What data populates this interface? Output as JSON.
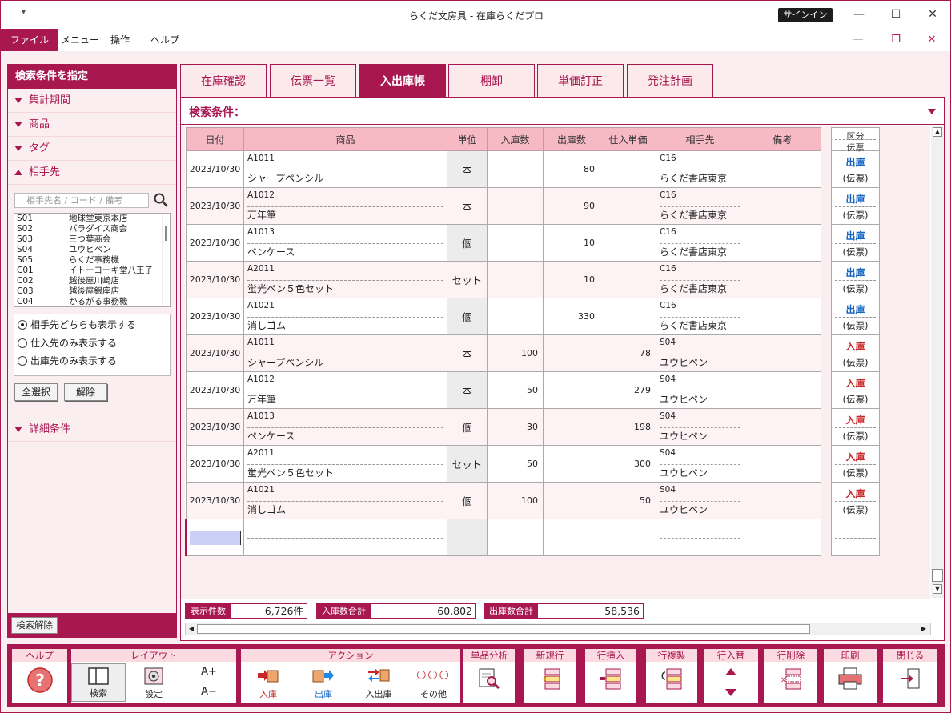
{
  "window": {
    "quick_access": "▾",
    "title": "らくだ文房具 - 在庫らくだプロ",
    "signin": "サインイン"
  },
  "menu": [
    "ファイル",
    "メニュー",
    "操作",
    "ヘルプ"
  ],
  "left": {
    "header": "検索条件を指定",
    "sections": [
      "集計期間",
      "商品",
      "タグ",
      "相手先"
    ],
    "partner_search_placeholder": "相手先名 / コード / 備考",
    "partners": [
      {
        "code": "S01",
        "name": "地球堂東京本店"
      },
      {
        "code": "S02",
        "name": "パラダイス商会"
      },
      {
        "code": "S03",
        "name": "三つ葉商会"
      },
      {
        "code": "S04",
        "name": "ユウヒペン"
      },
      {
        "code": "S05",
        "name": "らくだ事務機"
      },
      {
        "code": "C01",
        "name": "イトーヨーキ堂八王子"
      },
      {
        "code": "C02",
        "name": "越後屋川崎店"
      },
      {
        "code": "C03",
        "name": "越後屋銀座店"
      },
      {
        "code": "C04",
        "name": "かるがる事務機"
      }
    ],
    "radios": [
      "相手先どちらも表示する",
      "仕入先のみ表示する",
      "出庫先のみ表示する"
    ],
    "select_all": "全選択",
    "deselect": "解除",
    "details": "詳細条件",
    "clear_search": "検索解除"
  },
  "tabs": [
    "在庫確認",
    "伝票一覧",
    "入出庫帳",
    "棚卸",
    "単価訂正",
    "発注計画"
  ],
  "active_tab": "入出庫帳",
  "condition_label": "検索条件：",
  "columns": [
    "日付",
    "商品",
    "単位",
    "入庫数",
    "出庫数",
    "仕入単価",
    "相手先",
    "備考"
  ],
  "kubun_header": {
    "top": "区分",
    "bottom": "伝票"
  },
  "rows": [
    {
      "date": "2023/10/30",
      "code": "A1011",
      "name": "シャープペンシル",
      "unit": "本",
      "in": "",
      "out": "80",
      "price": "",
      "pcode": "C16",
      "pname": "らくだ書店東京",
      "kubun": "出庫",
      "slip": "(伝票)"
    },
    {
      "date": "2023/10/30",
      "code": "A1012",
      "name": "万年筆",
      "unit": "本",
      "in": "",
      "out": "90",
      "price": "",
      "pcode": "C16",
      "pname": "らくだ書店東京",
      "kubun": "出庫",
      "slip": "(伝票)"
    },
    {
      "date": "2023/10/30",
      "code": "A1013",
      "name": "ペンケース",
      "unit": "個",
      "in": "",
      "out": "10",
      "price": "",
      "pcode": "C16",
      "pname": "らくだ書店東京",
      "kubun": "出庫",
      "slip": "(伝票)"
    },
    {
      "date": "2023/10/30",
      "code": "A2011",
      "name": "蛍光ペン５色セット",
      "unit": "セット",
      "in": "",
      "out": "10",
      "price": "",
      "pcode": "C16",
      "pname": "らくだ書店東京",
      "kubun": "出庫",
      "slip": "(伝票)"
    },
    {
      "date": "2023/10/30",
      "code": "A1021",
      "name": "消しゴム",
      "unit": "個",
      "in": "",
      "out": "330",
      "price": "",
      "pcode": "C16",
      "pname": "らくだ書店東京",
      "kubun": "出庫",
      "slip": "(伝票)"
    },
    {
      "date": "2023/10/30",
      "code": "A1011",
      "name": "シャープペンシル",
      "unit": "本",
      "in": "100",
      "out": "",
      "price": "78",
      "pcode": "S04",
      "pname": "ユウヒペン",
      "kubun": "入庫",
      "slip": "(伝票)"
    },
    {
      "date": "2023/10/30",
      "code": "A1012",
      "name": "万年筆",
      "unit": "本",
      "in": "50",
      "out": "",
      "price": "279",
      "pcode": "S04",
      "pname": "ユウヒペン",
      "kubun": "入庫",
      "slip": "(伝票)"
    },
    {
      "date": "2023/10/30",
      "code": "A1013",
      "name": "ペンケース",
      "unit": "個",
      "in": "30",
      "out": "",
      "price": "198",
      "pcode": "S04",
      "pname": "ユウヒペン",
      "kubun": "入庫",
      "slip": "(伝票)"
    },
    {
      "date": "2023/10/30",
      "code": "A2011",
      "name": "蛍光ペン５色セット",
      "unit": "セット",
      "in": "50",
      "out": "",
      "price": "300",
      "pcode": "S04",
      "pname": "ユウヒペン",
      "kubun": "入庫",
      "slip": "(伝票)"
    },
    {
      "date": "2023/10/30",
      "code": "A1021",
      "name": "消しゴム",
      "unit": "個",
      "in": "100",
      "out": "",
      "price": "50",
      "pcode": "S04",
      "pname": "ユウヒペン",
      "kubun": "入庫",
      "slip": "(伝票)"
    }
  ],
  "totals": {
    "count_label": "表示件数",
    "count": "6,726件",
    "in_label": "入庫数合計",
    "in": "60,802",
    "out_label": "出庫数合計",
    "out": "58,536"
  },
  "toolbar": {
    "help": "ヘルプ",
    "layout": "レイアウト",
    "search": "検索",
    "settings": "設定",
    "font_up": "A+",
    "font_down": "A−",
    "action": "アクション",
    "in": "入庫",
    "out": "出庫",
    "inout": "入出庫",
    "other": "その他",
    "analysis": "単品分析",
    "new_row": "新規行",
    "insert_row": "行挿入",
    "copy_row": "行複製",
    "swap_row": "行入替",
    "delete_row": "行削除",
    "print": "印刷",
    "close": "閉じる"
  },
  "colors": {
    "accent": "#a8174f",
    "header_bg": "#f7b9c4",
    "in": "#c62828",
    "out": "#1565c0"
  }
}
